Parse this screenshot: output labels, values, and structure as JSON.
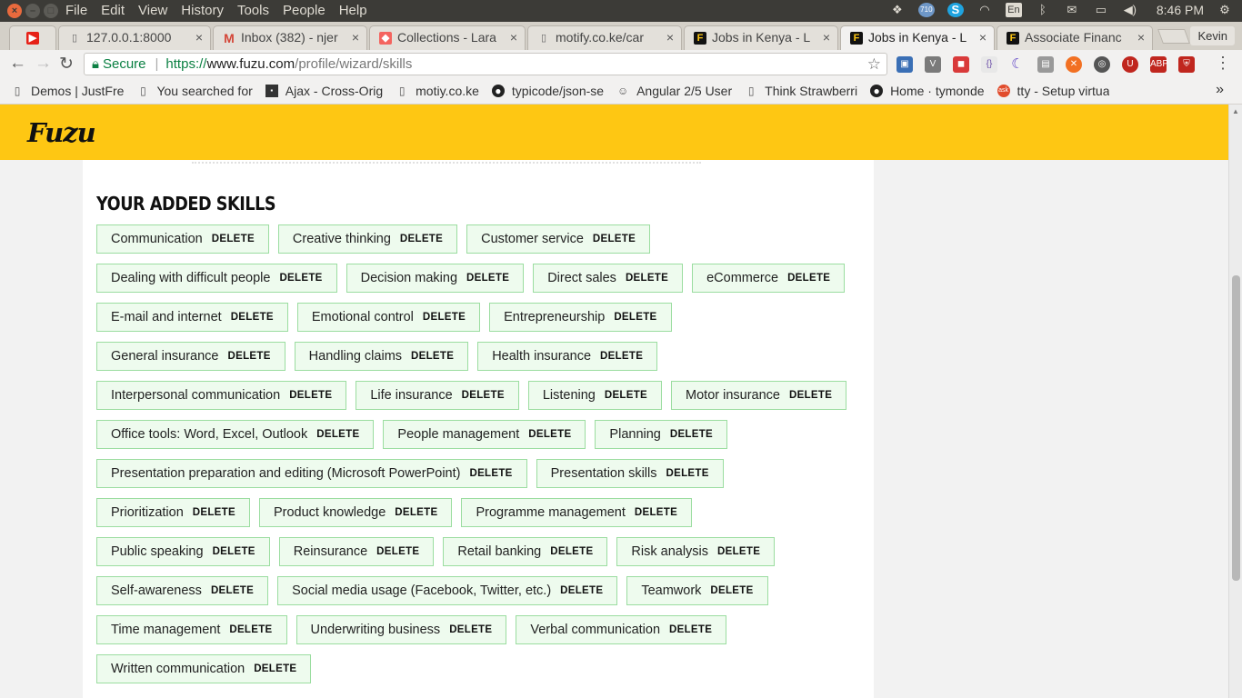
{
  "os": {
    "menu": [
      "File",
      "Edit",
      "View",
      "History",
      "Tools",
      "People",
      "Help"
    ],
    "tray_badge": "710",
    "keyboard": "En",
    "clock": "8:46 PM",
    "user": "Kevin"
  },
  "tabs": [
    {
      "title": "",
      "icon": "youtube-icon",
      "color": "#e62117"
    },
    {
      "title": "127.0.0.1:8000",
      "icon": "page-icon",
      "color": "#888888"
    },
    {
      "title": "Inbox (382) - njer",
      "icon": "gmail-icon",
      "color": "#d44638"
    },
    {
      "title": "Collections - Lara",
      "icon": "laravel-icon",
      "color": "#f4645f"
    },
    {
      "title": "motify.co.ke/car",
      "icon": "page-icon",
      "color": "#888888"
    },
    {
      "title": "Jobs in Kenya - L",
      "icon": "fuzu-icon",
      "color": "#111111"
    },
    {
      "title": "Jobs in Kenya - L",
      "icon": "fuzu-icon",
      "color": "#111111",
      "active": true
    },
    {
      "title": "Associate Financ",
      "icon": "fuzu-icon",
      "color": "#111111"
    }
  ],
  "address": {
    "secure_label": "Secure",
    "scheme": "https://",
    "host": "www.fuzu.com",
    "path": "/profile/wizard/skills"
  },
  "bookmarks": [
    {
      "label": "Demos | JustFre",
      "icon": "page-icon"
    },
    {
      "label": "You searched for",
      "icon": "page-icon"
    },
    {
      "label": "Ajax - Cross-Orig",
      "icon": "site-icon"
    },
    {
      "label": "motiy.co.ke",
      "icon": "page-icon"
    },
    {
      "label": "typicode/json-se",
      "icon": "github-icon"
    },
    {
      "label": "Angular 2/5 User",
      "icon": "user-icon"
    },
    {
      "label": "Think Strawberri",
      "icon": "page-icon"
    },
    {
      "label": "Home · tymonde",
      "icon": "github-icon"
    },
    {
      "label": "tty - Setup virtua",
      "icon": "ask-icon"
    }
  ],
  "site": {
    "logo": "Fuzu"
  },
  "skills_section": {
    "title": "YOUR ADDED SKILLS",
    "delete_label": "DELETE",
    "skills": [
      "Communication",
      "Creative thinking",
      "Customer service",
      "Dealing with difficult people",
      "Decision making",
      "Direct sales",
      "eCommerce",
      "E-mail and internet",
      "Emotional control",
      "Entrepreneurship",
      "General insurance",
      "Handling claims",
      "Health insurance",
      "Interpersonal communication",
      "Life insurance",
      "Listening",
      "Motor insurance",
      "Office tools: Word, Excel, Outlook",
      "People management",
      "Planning",
      "Presentation preparation and editing (Microsoft PowerPoint)",
      "Presentation skills",
      "Prioritization",
      "Product knowledge",
      "Programme management",
      "Public speaking",
      "Reinsurance",
      "Retail banking",
      "Risk analysis",
      "Self-awareness",
      "Social media usage (Facebook, Twitter, etc.)",
      "Teamwork",
      "Time management",
      "Underwriting business",
      "Verbal communication",
      "Written communication"
    ]
  }
}
